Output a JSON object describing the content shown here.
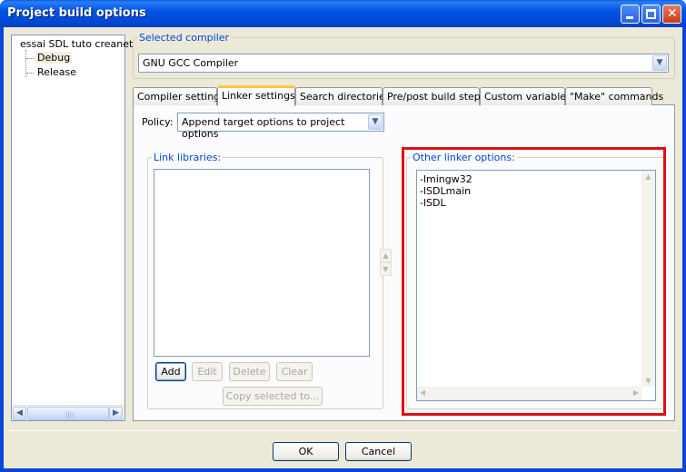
{
  "window": {
    "title": "Project build options"
  },
  "tree": {
    "items": [
      "essai SDL tuto creanet",
      "Debug",
      "Release"
    ]
  },
  "compiler": {
    "legend": "Selected compiler",
    "value": "GNU GCC Compiler"
  },
  "tabs": [
    {
      "label": "Compiler settings",
      "active": false
    },
    {
      "label": "Linker settings",
      "active": true
    },
    {
      "label": "Search directories",
      "active": false
    },
    {
      "label": "Pre/post build steps",
      "active": false
    },
    {
      "label": "Custom variables",
      "active": false
    },
    {
      "label": "\"Make\" commands",
      "active": false
    }
  ],
  "policy": {
    "label": "Policy:",
    "value": "Append target options to project options"
  },
  "link_libraries": {
    "legend": "Link libraries:",
    "buttons": {
      "add": "Add",
      "edit": "Edit",
      "delete": "Delete",
      "clear": "Clear",
      "copy": "Copy selected to..."
    }
  },
  "other_linker": {
    "legend": "Other linker options:",
    "lines": [
      "-lmingw32",
      "-lSDLmain",
      "-lSDL"
    ]
  },
  "footer": {
    "ok": "OK",
    "cancel": "Cancel"
  },
  "colors": {
    "title_bar": "#0055e5",
    "legend_text": "#0046d5",
    "highlight_box": "#e01010",
    "tab_active_accent": "#ffc83c"
  }
}
